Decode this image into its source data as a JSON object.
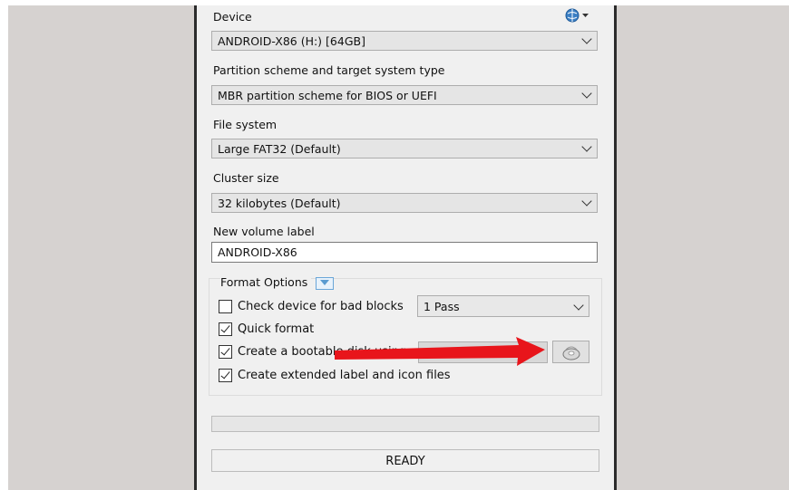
{
  "device": {
    "label": "Device",
    "value": "ANDROID-X86 (H:) [64GB]"
  },
  "partition": {
    "label": "Partition scheme and target system type",
    "value": "MBR partition scheme for BIOS or UEFI"
  },
  "filesystem": {
    "label": "File system",
    "value": "Large FAT32 (Default)"
  },
  "cluster": {
    "label": "Cluster size",
    "value": "32 kilobytes (Default)"
  },
  "volume": {
    "label": "New volume label",
    "value": "ANDROID-X86"
  },
  "format_options": {
    "title": "Format Options",
    "bad_blocks": {
      "label": "Check device for bad blocks",
      "checked": false,
      "passes": "1 Pass"
    },
    "quick_format": {
      "label": "Quick format",
      "checked": true
    },
    "bootable": {
      "label": "Create a bootable disk using",
      "checked": true
    },
    "extended_label": {
      "label": "Create extended label and icon files",
      "checked": true
    }
  },
  "status": {
    "text": "READY"
  },
  "icons": {
    "language": "language-icon",
    "disk": "disk-image-icon",
    "annotation": "red-arrow"
  },
  "colors": {
    "arrow": "#e8151b",
    "window_bg": "#f0f0f0",
    "outer_bg": "#d6d2d0"
  }
}
